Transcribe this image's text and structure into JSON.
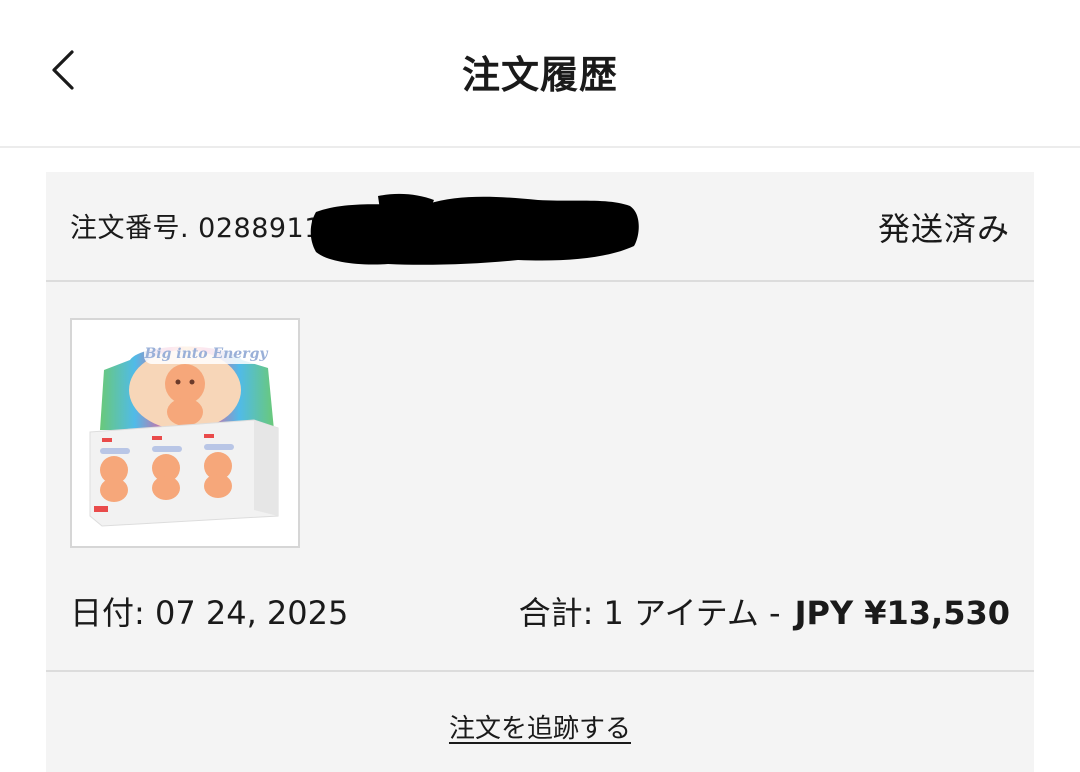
{
  "header": {
    "title": "注文履歴",
    "back_icon": "chevron-left-icon"
  },
  "order": {
    "number_label": "注文番号. 0288911223",
    "status": "発送済み",
    "product_image": {
      "box_label": "Big into Energy",
      "icon": "product-thumbnail"
    },
    "date_label": "日付: 07 24, 2025",
    "total_label": "合計: 1 アイテム -",
    "total_amount": "JPY ¥13,530",
    "track_label": "注文を追跡する"
  },
  "colors": {
    "background": "#ffffff",
    "card": "#f4f4f4",
    "divider": "#dcdcdc",
    "text": "#1a1a1a",
    "redaction": "#000000"
  }
}
